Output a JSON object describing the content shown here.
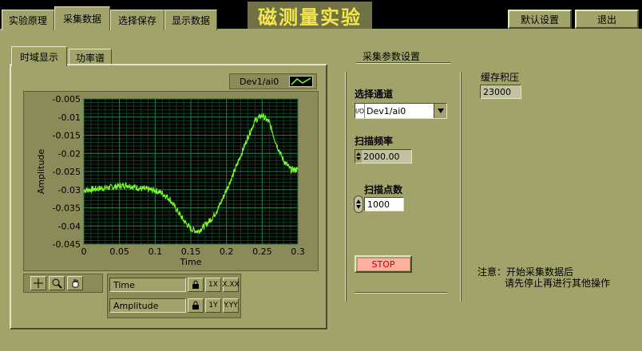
{
  "app_title": "磁测量实验",
  "top_tabs": [
    "实验原理",
    "采集数据",
    "选择保存",
    "显示数据"
  ],
  "active_tab_index": 1,
  "buttons": {
    "default_settings": "默认设置",
    "exit": "退出",
    "stop": "STOP"
  },
  "graph_tabs": [
    "时域显示",
    "功率谱"
  ],
  "legend": {
    "channel_name": "Dev1/ai0",
    "line_color": "#7cff2a"
  },
  "palette": {
    "x_name": "Time",
    "y_name": "Amplitude",
    "x_format_btn": "X.XX",
    "y_format_btn": "Y.YY",
    "x_scale_btn": "1X",
    "y_scale_btn": "1Y"
  },
  "settings": {
    "section_title": "采集参数设置",
    "channel_label": "选择通道",
    "channel_value": "Dev1/ai0",
    "rate_label": "扫描频率",
    "rate_value": "2000.00",
    "points_label": "扫描点数",
    "points_value": "1000",
    "buffer_label": "缓存积压",
    "buffer_value": "23000"
  },
  "note": {
    "line1": "注意：开始采集数据后",
    "line2": "请先停止再进行其他操作"
  },
  "chart_data": {
    "type": "line",
    "title": "",
    "xlabel": "Time",
    "ylabel": "Amplitude",
    "xlim": [
      0,
      0.3
    ],
    "ylim": [
      -0.045,
      -0.005
    ],
    "x_ticks": [
      0,
      0.05,
      0.1,
      0.15,
      0.2,
      0.25,
      0.3
    ],
    "y_ticks": [
      -0.005,
      -0.01,
      -0.015,
      -0.02,
      -0.025,
      -0.03,
      -0.035,
      -0.04,
      -0.045
    ],
    "grid": true,
    "series": [
      {
        "name": "Dev1/ai0",
        "x": [
          0,
          0.02,
          0.04,
          0.06,
          0.08,
          0.1,
          0.11,
          0.12,
          0.13,
          0.14,
          0.15,
          0.16,
          0.17,
          0.18,
          0.19,
          0.2,
          0.21,
          0.22,
          0.23,
          0.24,
          0.25,
          0.26,
          0.27,
          0.28,
          0.29,
          0.3
        ],
        "y": [
          -0.0302,
          -0.0297,
          -0.0293,
          -0.0287,
          -0.0297,
          -0.0302,
          -0.031,
          -0.0325,
          -0.0355,
          -0.0385,
          -0.0408,
          -0.0415,
          -0.0398,
          -0.0378,
          -0.0345,
          -0.03,
          -0.0255,
          -0.0205,
          -0.0155,
          -0.011,
          -0.0095,
          -0.0115,
          -0.0175,
          -0.022,
          -0.0245,
          -0.0245
        ]
      }
    ]
  }
}
